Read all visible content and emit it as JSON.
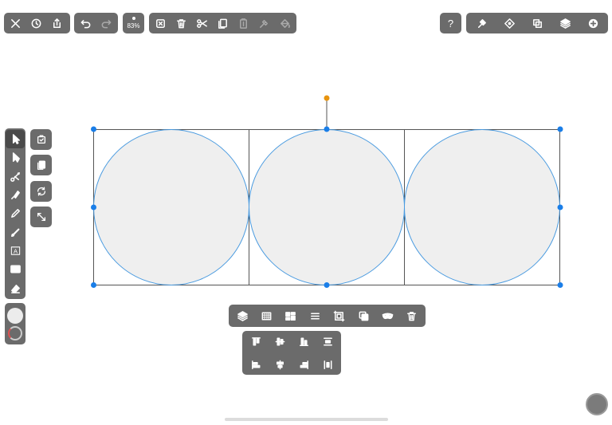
{
  "toolbar": {
    "zoom_label": "83%",
    "file_group": [
      "close-icon",
      "history-icon",
      "share-icon"
    ],
    "history_group": [
      "undo-icon",
      "redo-icon"
    ],
    "edit_group": [
      "deselect-icon",
      "delete-icon",
      "cut-icon",
      "copy-icon",
      "paste-icon",
      "paste-style-icon",
      "fill-icon"
    ],
    "help_label": "?",
    "right_group": [
      "inspector-icon",
      "shape-icon",
      "arrange-icon",
      "layers-icon",
      "add-icon"
    ]
  },
  "left_tools": [
    "selection-arrow-icon",
    "direct-select-icon",
    "scissors-icon",
    "pen-icon",
    "pencil-icon",
    "brush-icon",
    "text-icon",
    "rectangle-icon",
    "eraser-icon"
  ],
  "text_tool_glyph": "A",
  "side_buttons": [
    "select-same-icon",
    "select-all-icon",
    "rotate-icon",
    "resize-icon"
  ],
  "context_menu": [
    "layers-icon",
    "transparency-icon",
    "distribute-icon",
    "align-lines-icon",
    "crop-icon",
    "combine-icon",
    "mask-icon",
    "delete-icon"
  ],
  "align_menu": {
    "row1": [
      "align-top-icon",
      "align-middle-icon",
      "align-bottom-icon",
      "distribute-vertical-icon"
    ],
    "row2": [
      "align-left-icon",
      "align-center-icon",
      "align-right-icon",
      "distribute-horizontal-icon"
    ]
  },
  "colors": {
    "panel": "#6b6b6b",
    "circle_fill": "#efefef",
    "circle_stroke": "#4a9be0",
    "handle": "#1a7ee8",
    "rotate_handle": "#e8940f"
  }
}
